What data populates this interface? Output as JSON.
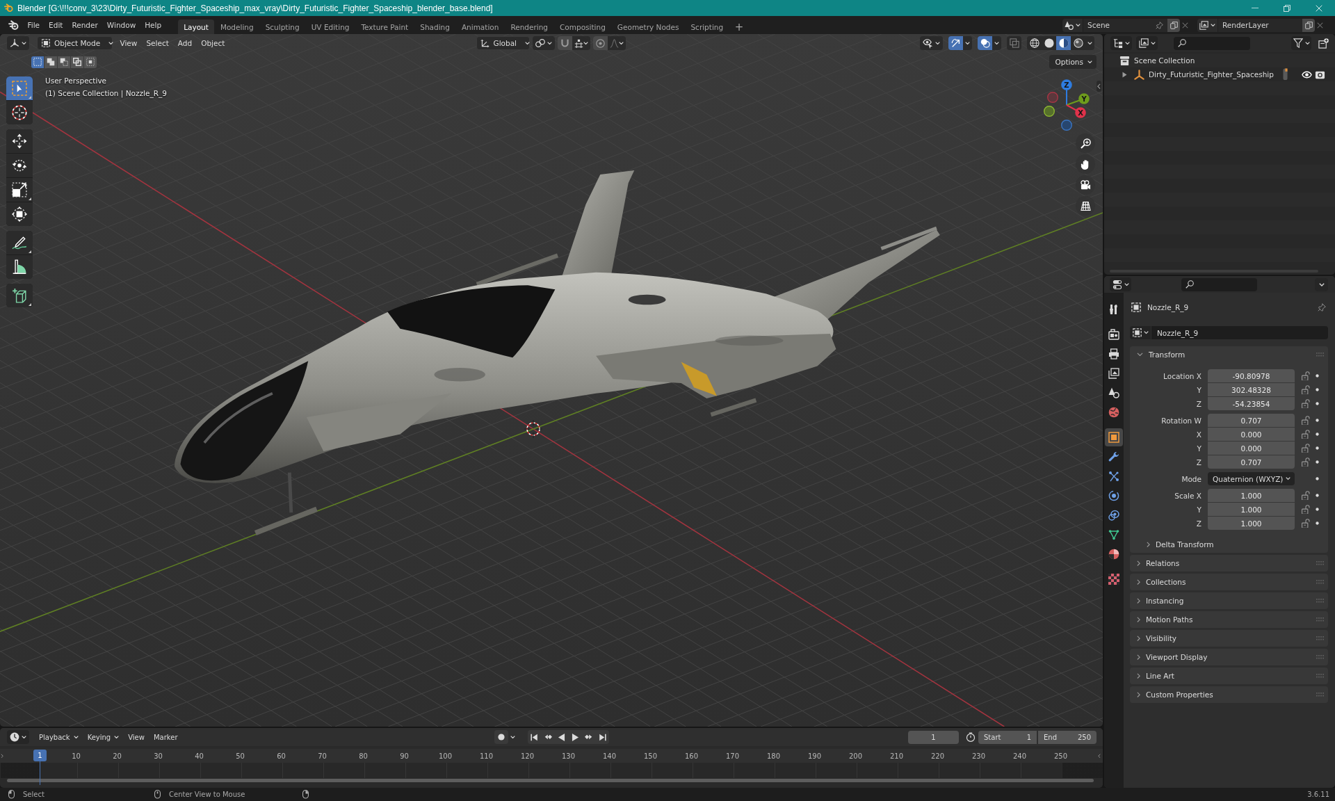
{
  "window": {
    "title": "Blender [G:\\!!!conv_3\\23\\Dirty_Futuristic_Fighter_Spaceship_max_vray\\Dirty_Futuristic_Fighter_Spaceship_blender_base.blend]"
  },
  "menu": [
    "File",
    "Edit",
    "Render",
    "Window",
    "Help"
  ],
  "workspaces": [
    {
      "label": "Layout",
      "selected": true
    },
    {
      "label": "Modeling",
      "selected": false
    },
    {
      "label": "Sculpting",
      "selected": false
    },
    {
      "label": "UV Editing",
      "selected": false
    },
    {
      "label": "Texture Paint",
      "selected": false
    },
    {
      "label": "Shading",
      "selected": false
    },
    {
      "label": "Animation",
      "selected": false
    },
    {
      "label": "Rendering",
      "selected": false
    },
    {
      "label": "Compositing",
      "selected": false
    },
    {
      "label": "Geometry Nodes",
      "selected": false
    },
    {
      "label": "Scripting",
      "selected": false
    }
  ],
  "add_workspace": "+",
  "scene": {
    "name": "Scene"
  },
  "view_layer": {
    "name": "RenderLayer"
  },
  "viewport": {
    "mode": "Object Mode",
    "menus": [
      "View",
      "Select",
      "Add",
      "Object"
    ],
    "orientation": "Global",
    "snap": {
      "on": false
    },
    "proportional": {
      "on": false
    },
    "toggles": [
      {
        "on": true
      },
      {
        "on": true
      },
      {
        "on": false
      }
    ],
    "shading": [
      {
        "selected": false
      },
      {
        "selected": false
      },
      {
        "selected": true
      },
      {
        "selected": false
      }
    ],
    "select_modes": [
      {
        "selected": true
      },
      {
        "selected": false
      },
      {
        "selected": false
      },
      {
        "selected": false
      },
      {
        "selected": false
      }
    ],
    "options": "Options",
    "tools": [
      {
        "selected": true,
        "flyout": true
      },
      {
        "selected": false,
        "flyout": false
      },
      {
        "selected": false,
        "flyout": false
      },
      {
        "selected": false,
        "flyout": false
      },
      {
        "selected": false,
        "flyout": true
      },
      {
        "selected": false,
        "flyout": false
      },
      {
        "selected": false,
        "flyout": true
      },
      {
        "selected": false,
        "flyout": false
      },
      {
        "selected": false,
        "flyout": true
      }
    ],
    "overlay_text": [
      "User Perspective",
      "(1) Scene Collection | Nozzle_R_9"
    ],
    "gizmo_axes": [
      "Z",
      "Y",
      "X"
    ]
  },
  "outliner": {
    "tree": [
      {
        "label": "Scene Collection",
        "kind": "collection",
        "children": [
          {
            "label": "Dirty_Futuristic_Fighter_Spaceship",
            "kind": "empty",
            "expanded": false,
            "visible": true,
            "renderable": true
          }
        ]
      }
    ]
  },
  "properties": {
    "tabs": [
      {
        "selected": false
      },
      {
        "selected": false
      },
      {
        "selected": false
      },
      {
        "selected": false
      },
      {
        "selected": false
      },
      {
        "selected": false
      },
      {
        "selected": true
      },
      {
        "selected": false
      },
      {
        "selected": false
      },
      {
        "selected": false
      },
      {
        "selected": false
      },
      {
        "selected": false
      },
      {
        "selected": false
      },
      {
        "selected": false
      }
    ],
    "object": "Nozzle_R_9",
    "datablock": "Nozzle_R_9",
    "panels": [
      {
        "title": "Transform",
        "expanded": true,
        "groups": [
          {
            "fields": [
              {
                "label": "Location X",
                "value": "-90.80978",
                "kind": "number",
                "locked": false
              },
              {
                "label": "Y",
                "value": "302.48328",
                "kind": "number",
                "locked": false
              },
              {
                "label": "Z",
                "value": "-54.23854",
                "kind": "number",
                "locked": false
              }
            ]
          },
          {
            "fields": [
              {
                "label": "Rotation W",
                "value": "0.707",
                "kind": "number",
                "locked": false
              },
              {
                "label": "X",
                "value": "0.000",
                "kind": "number",
                "locked": false
              },
              {
                "label": "Y",
                "value": "0.000",
                "kind": "number",
                "locked": false
              },
              {
                "label": "Z",
                "value": "0.707",
                "kind": "number",
                "locked": false
              }
            ]
          },
          {
            "fields": [
              {
                "label": "Mode",
                "value": "Quaternion (WXYZ)",
                "kind": "dropdown"
              }
            ]
          },
          {
            "fields": [
              {
                "label": "Scale X",
                "value": "1.000",
                "kind": "number",
                "locked": false
              },
              {
                "label": "Y",
                "value": "1.000",
                "kind": "number",
                "locked": false
              },
              {
                "label": "Z",
                "value": "1.000",
                "kind": "number",
                "locked": false
              }
            ]
          }
        ],
        "subpanels": [
          {
            "title": "Delta Transform",
            "expanded": false
          }
        ]
      },
      {
        "title": "Relations",
        "expanded": false
      },
      {
        "title": "Collections",
        "expanded": false
      },
      {
        "title": "Instancing",
        "expanded": false
      },
      {
        "title": "Motion Paths",
        "expanded": false
      },
      {
        "title": "Visibility",
        "expanded": false
      },
      {
        "title": "Viewport Display",
        "expanded": false
      },
      {
        "title": "Line Art",
        "expanded": false
      },
      {
        "title": "Custom Properties",
        "expanded": false
      }
    ]
  },
  "timeline": {
    "menus": [
      "Playback",
      "Keying",
      "View",
      "Marker"
    ],
    "frame": "1",
    "start": {
      "label": "Start",
      "value": "1"
    },
    "end": {
      "label": "End",
      "value": "250"
    },
    "playhead": "1",
    "ruler": [
      "10",
      "20",
      "30",
      "40",
      "50",
      "60",
      "70",
      "80",
      "90",
      "100",
      "110",
      "120",
      "130",
      "140",
      "150",
      "160",
      "170",
      "180",
      "190",
      "200",
      "210",
      "220",
      "230",
      "240",
      "250"
    ]
  },
  "status_bar": {
    "hints": [
      "Select",
      "Center View to Mouse"
    ],
    "version": "3.6.11"
  }
}
